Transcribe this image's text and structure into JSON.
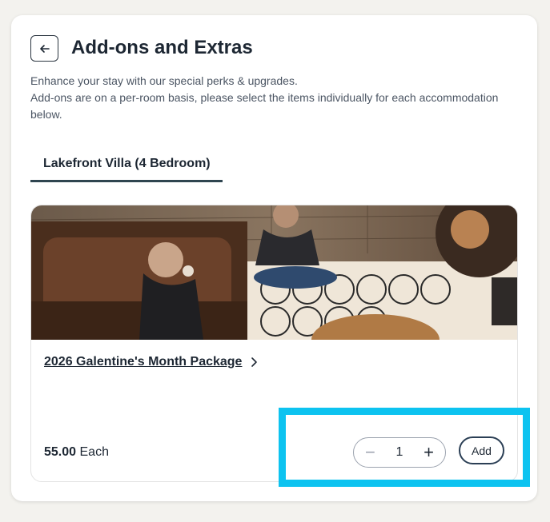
{
  "header": {
    "title": "Add-ons and Extras",
    "description_line1": "Enhance your stay with our special perks & upgrades.",
    "description_line2": "Add-ons are on a per-room basis, please select the items individually for each accommodation below."
  },
  "tabs": [
    {
      "label": "Lakefront Villa (4 Bedroom)",
      "active": true
    }
  ],
  "addon": {
    "title": "2026 Galentine's Month Package",
    "price": "55.00",
    "price_unit": "Each",
    "quantity": "1",
    "add_label": "Add",
    "minus_symbol": "−",
    "plus_symbol": "+"
  },
  "colors": {
    "accent_border": "#2f4550",
    "highlight": "#0dc3f0"
  },
  "icons": {
    "back": "arrow-left-icon",
    "chevron": "chevron-right-icon"
  }
}
